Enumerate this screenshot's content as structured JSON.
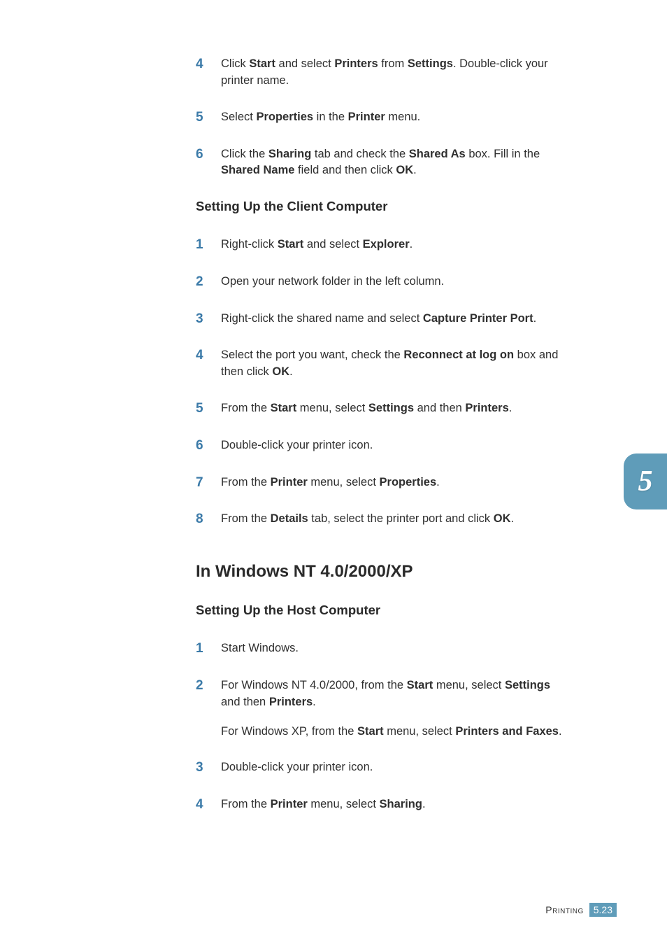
{
  "chapterTab": "5",
  "footer": {
    "label": "Printing",
    "chapter": "5",
    "pagePart": "23"
  },
  "list1": [
    {
      "num": "4",
      "segments": [
        {
          "t": "Click "
        },
        {
          "t": "Start",
          "b": true
        },
        {
          "t": " and select "
        },
        {
          "t": "Printers",
          "b": true
        },
        {
          "t": " from "
        },
        {
          "t": "Settings",
          "b": true
        },
        {
          "t": ". Double-click your printer name."
        }
      ]
    },
    {
      "num": "5",
      "segments": [
        {
          "t": "Select "
        },
        {
          "t": "Properties",
          "b": true
        },
        {
          "t": " in the "
        },
        {
          "t": "Printer",
          "b": true
        },
        {
          "t": " menu."
        }
      ]
    },
    {
      "num": "6",
      "segments": [
        {
          "t": "Click the "
        },
        {
          "t": "Sharing",
          "b": true
        },
        {
          "t": " tab and check the "
        },
        {
          "t": "Shared As",
          "b": true
        },
        {
          "t": " box. Fill in the "
        },
        {
          "t": "Shared Name",
          "b": true
        },
        {
          "t": " field and then click "
        },
        {
          "t": "OK",
          "b": true
        },
        {
          "t": "."
        }
      ]
    }
  ],
  "sub1": "Setting Up the Client Computer",
  "list2": [
    {
      "num": "1",
      "segments": [
        {
          "t": "Right-click "
        },
        {
          "t": "Start",
          "b": true
        },
        {
          "t": " and select "
        },
        {
          "t": "Explorer",
          "b": true
        },
        {
          "t": "."
        }
      ]
    },
    {
      "num": "2",
      "segments": [
        {
          "t": "Open your network folder in the left column."
        }
      ]
    },
    {
      "num": "3",
      "segments": [
        {
          "t": "Right-click the shared name and select "
        },
        {
          "t": "Capture Printer Port",
          "b": true
        },
        {
          "t": "."
        }
      ]
    },
    {
      "num": "4",
      "segments": [
        {
          "t": "Select the port you want, check the "
        },
        {
          "t": "Reconnect at log on",
          "b": true
        },
        {
          "t": " box and then click "
        },
        {
          "t": "OK",
          "b": true
        },
        {
          "t": "."
        }
      ]
    },
    {
      "num": "5",
      "segments": [
        {
          "t": "From the "
        },
        {
          "t": "Start",
          "b": true
        },
        {
          "t": " menu, select "
        },
        {
          "t": "Settings",
          "b": true
        },
        {
          "t": " and then "
        },
        {
          "t": "Printers",
          "b": true
        },
        {
          "t": "."
        }
      ]
    },
    {
      "num": "6",
      "segments": [
        {
          "t": "Double-click your printer icon."
        }
      ]
    },
    {
      "num": "7",
      "segments": [
        {
          "t": "From the "
        },
        {
          "t": "Printer",
          "b": true
        },
        {
          "t": " menu, select "
        },
        {
          "t": "Properties",
          "b": true
        },
        {
          "t": "."
        }
      ]
    },
    {
      "num": "8",
      "segments": [
        {
          "t": "From the "
        },
        {
          "t": "Details",
          "b": true
        },
        {
          "t": " tab, select the printer port and click "
        },
        {
          "t": "OK",
          "b": true
        },
        {
          "t": "."
        }
      ]
    }
  ],
  "section2": "In Windows NT 4.0/2000/XP",
  "sub2": "Setting Up the Host Computer",
  "list3": [
    {
      "num": "1",
      "segments": [
        {
          "t": "Start Windows."
        }
      ]
    },
    {
      "num": "2",
      "segments": [
        {
          "t": "For Windows NT 4.0/2000, from the "
        },
        {
          "t": "Start",
          "b": true
        },
        {
          "t": " menu, select "
        },
        {
          "t": "Settings",
          "b": true
        },
        {
          "t": " and then "
        },
        {
          "t": "Printers",
          "b": true
        },
        {
          "t": "."
        }
      ],
      "segments2": [
        {
          "t": "For Windows XP, from the "
        },
        {
          "t": "Start",
          "b": true
        },
        {
          "t": " menu, select "
        },
        {
          "t": "Printers and Faxes",
          "b": true
        },
        {
          "t": "."
        }
      ]
    },
    {
      "num": "3",
      "segments": [
        {
          "t": "Double-click your printer icon."
        }
      ]
    },
    {
      "num": "4",
      "segments": [
        {
          "t": "From the "
        },
        {
          "t": "Printer",
          "b": true
        },
        {
          "t": " menu, select "
        },
        {
          "t": "Sharing",
          "b": true
        },
        {
          "t": "."
        }
      ]
    }
  ]
}
